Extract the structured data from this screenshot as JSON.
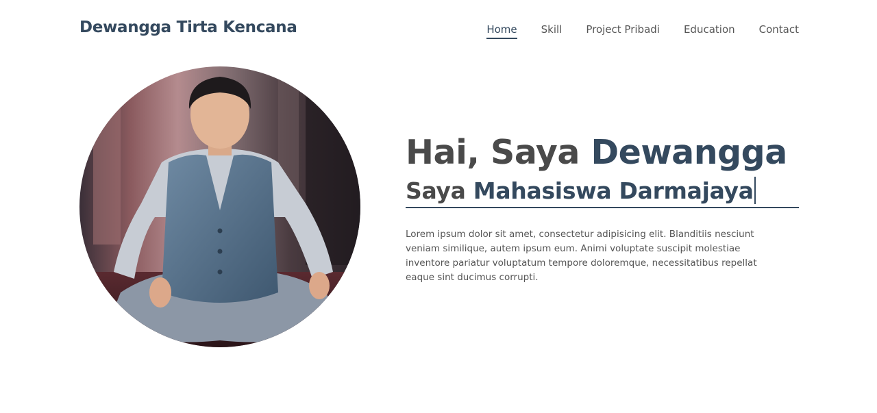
{
  "header": {
    "brand": "Dewangga Tirta Kencana",
    "nav": [
      {
        "label": "Home",
        "active": true
      },
      {
        "label": "Skill",
        "active": false
      },
      {
        "label": "Project Pribadi",
        "active": false
      },
      {
        "label": "Education",
        "active": false
      },
      {
        "label": "Contact",
        "active": false
      }
    ]
  },
  "hero": {
    "greeting": "Hai, Saya ",
    "name": "Dewangga",
    "role_prefix": "Saya ",
    "role": "Mahasiswa Darmajaya",
    "description": "Lorem ipsum dolor sit amet, consectetur adipisicing elit. Blanditiis nesciunt veniam similique, autem ipsum eum. Animi voluptate suscipit molestiae inventore pariatur voluptatum tempore doloremque, necessitatibus repellat eaque sint ducimus corrupti."
  },
  "colors": {
    "accent": "#34495e",
    "text": "#4a4a4a",
    "muted": "#555555"
  }
}
